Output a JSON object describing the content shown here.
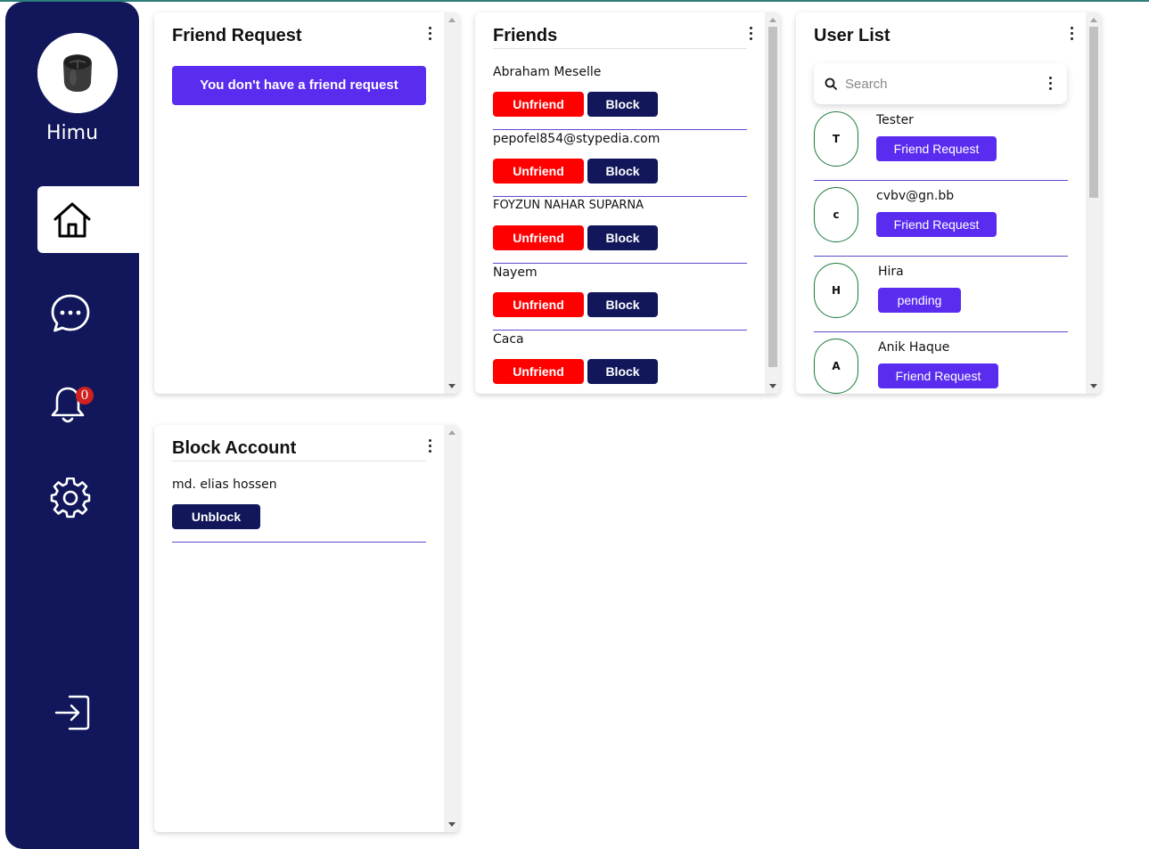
{
  "sidebar": {
    "user_name": "Himu",
    "nav": [
      {
        "icon": "home-icon",
        "active": true
      },
      {
        "icon": "chat-icon"
      },
      {
        "icon": "bell-icon",
        "badge": "0"
      },
      {
        "icon": "gear-icon"
      },
      {
        "icon": "logout-icon"
      }
    ],
    "notification_count": "0"
  },
  "friend_request": {
    "title": "Friend Request",
    "empty_message": "You don't have a friend request"
  },
  "friends": {
    "title": "Friends",
    "unfriend_label": "Unfriend",
    "block_label": "Block",
    "items": [
      {
        "name": "Abraham Meselle"
      },
      {
        "name": "pepofel854@stypedia.com"
      },
      {
        "name": "FOYZUN NAHAR SUPARNA"
      },
      {
        "name": "Nayem"
      },
      {
        "name": "Caca"
      }
    ]
  },
  "user_list": {
    "title": "User List",
    "search_placeholder": "Search",
    "items": [
      {
        "initial": "T",
        "name": "Tester",
        "action": "Friend Request"
      },
      {
        "initial": "c",
        "name": "cvbv@gn.bb",
        "action": "Friend Request"
      },
      {
        "initial": "H",
        "name": "Hira",
        "action": "pending"
      },
      {
        "initial": "A",
        "name": "Anik Haque",
        "action": "Friend Request"
      }
    ]
  },
  "block_account": {
    "title": "Block Account",
    "items": [
      {
        "name": "md. elias hossen",
        "action": "Unblock"
      }
    ]
  },
  "colors": {
    "sidebar": "#11175a",
    "primary": "#5a2cf0",
    "danger": "#ff0000",
    "navy_button": "#11175a"
  }
}
